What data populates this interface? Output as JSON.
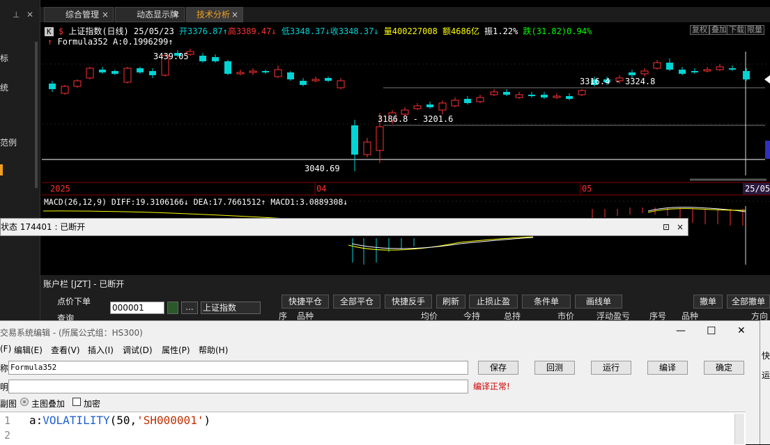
{
  "left_panel": {
    "items": [
      "标",
      "统",
      "范例"
    ]
  },
  "tabs": [
    {
      "label": "综合管理",
      "close": "×"
    },
    {
      "label": "动态显示牌",
      "close": "×"
    },
    {
      "label": "技术分析",
      "close": "×"
    }
  ],
  "chart": {
    "k_badge": "K",
    "dollar": "$",
    "index_name": "上证指数(日线)",
    "date": "25/05/23",
    "open": "开3376.87↑",
    "high": "高3389.47↓",
    "low": "低3348.37↓",
    "close": "收3348.37↓",
    "volume": "量400227008",
    "amount": "额4686亿",
    "amplitude": "振1.22%",
    "change": "跌(31.82)0.94%",
    "formula_line": "Formula352  A:0.1996299↑",
    "buttons": [
      "复权",
      "叠加",
      "下载",
      "限量"
    ],
    "labels": {
      "p1": "3439.05",
      "p2": "3316.4 - 3324.8",
      "p3": "3186.8 - 3201.6",
      "p4": "3040.69"
    },
    "time_axis": {
      "t1": "2025",
      "t2": "04",
      "t3": "05",
      "t4": "25/05"
    },
    "macd_line": "MACD(26,12,9)  DIFF:19.3106166↓ DEA:17.7661512↑ MACD1:3.0889308↓",
    "colors": {
      "up": "#ff3232",
      "down": "#00d4d4",
      "diff": "#ffff00",
      "dea": "#ffffff",
      "macd": "#ff00ff"
    }
  },
  "popup": {
    "text": "状态 174401 : 已断开",
    "pin": "⊡",
    "close": "×"
  },
  "account": {
    "title": "账户栏 [JZT]  - 已断开",
    "order_label": "点价下单",
    "query_label": "查询",
    "code_value": "000001",
    "name_value": "上证指数",
    "dots": "...",
    "buttons": [
      "快捷平仓",
      "全部平仓",
      "快捷反手",
      "刷新",
      "止损止盈",
      "条件单",
      "画线单",
      "撤单",
      "全部撤单"
    ],
    "headers": [
      "序",
      "品种",
      "均价",
      "今持",
      "总持",
      "市价",
      "浮动盈亏",
      "序号",
      "品种",
      "方向"
    ]
  },
  "editor": {
    "title": "交易系统编辑 - (所属公式组：HS300)",
    "menus": [
      "(F)",
      "编辑(E)",
      "查看(V)",
      "插入(I)",
      "调试(D)",
      "属性(P)",
      "帮助(H)"
    ],
    "name_label": "称:",
    "name_value": "Formula352",
    "desc_label": "明:",
    "buttons": [
      "保存",
      "回测",
      "运行",
      "编译",
      "确定"
    ],
    "status": "编译正常!",
    "opt1": "副图",
    "opt2": "主图叠加",
    "opt3": "加密",
    "line_nums": [
      "1",
      "2"
    ],
    "code_a": "a:",
    "code_fn": "VOLATILITY",
    "code_args_open": "(50,",
    "code_str": "'SH000001'",
    "code_close": ")",
    "win_min": "—",
    "win_max": "☐",
    "win_close": "✕"
  },
  "right_strip": {
    "t1": "快",
    "t2": "运"
  }
}
